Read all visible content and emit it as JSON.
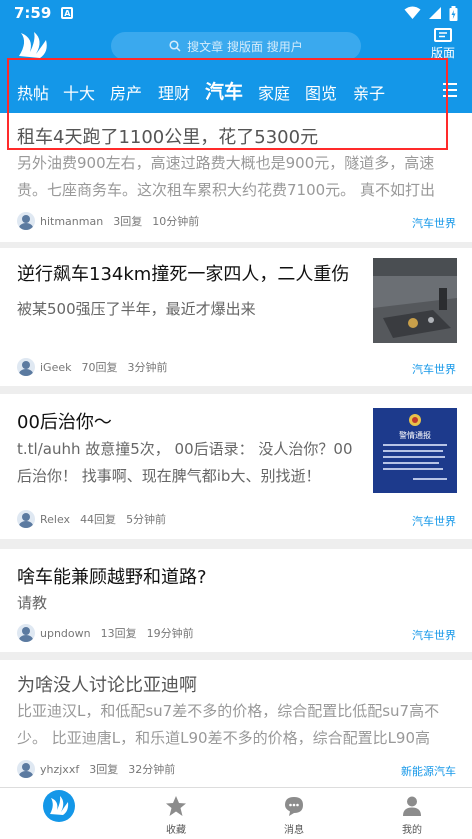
{
  "status": {
    "time": "7:59",
    "a_icon": "A"
  },
  "header": {
    "search_placeholder": "搜文章 搜版面 搜用户",
    "banmian_label": "版面"
  },
  "tabs": [
    {
      "label": "热帖"
    },
    {
      "label": "十大"
    },
    {
      "label": "房产"
    },
    {
      "label": "理财"
    },
    {
      "label": "汽车"
    },
    {
      "label": "家庭"
    },
    {
      "label": "图览"
    },
    {
      "label": "亲子"
    }
  ],
  "active_tab": "汽车",
  "posts": [
    {
      "title": "租车4天跑了1100公里，花了5300元",
      "body_lines": [
        "另外油费900左右，高速过路费大概也是900元，隧道多，高速",
        "贵。七座商务车。这次租车累积大约花费7100元。 真不如打出"
      ],
      "user": "hitmanman",
      "replies": "3回复",
      "time": "10分钟前",
      "category": "汽车世界"
    },
    {
      "title": "逆行飙车134km撞死一家四人，二人重伤",
      "body_lines": [
        "被某500强压了半年，最近才爆出来"
      ],
      "user": "iGeek",
      "replies": "70回复",
      "time": "3分钟前",
      "category": "汽车世界"
    },
    {
      "title": "00后治你～",
      "body_lines": [
        "t.tl/auhh 故意撞5次， 00后语录： 没人治你？00",
        "后治你！ 找事啊、现在脾气都ib大、别找逝！"
      ],
      "user": "Relex",
      "replies": "44回复",
      "time": "5分钟前",
      "category": "汽车世界",
      "thumb_text": "警情通报"
    },
    {
      "title": "啥车能兼顾越野和道路?",
      "body_lines": [
        "请教"
      ],
      "user": "upndown",
      "replies": "13回复",
      "time": "19分钟前",
      "category": "汽车世界"
    },
    {
      "title": "为啥没人讨论比亚迪啊",
      "body_lines": [
        "比亚迪汉L，和低配su7差不多的价格，综合配置比低配su7高不",
        "少。 比亚迪唐L，和乐道L90差不多的价格，综合配置比L90高"
      ],
      "user": "yhzjxxf",
      "replies": "3回复",
      "time": "32分钟前",
      "category": "新能源汽车"
    }
  ],
  "bottom_nav": [
    {
      "label": ""
    },
    {
      "label": "收藏"
    },
    {
      "label": "消息"
    },
    {
      "label": "我的"
    }
  ],
  "colors": {
    "brand": "#1497e8",
    "highlight_box": "#ff2a2a"
  }
}
